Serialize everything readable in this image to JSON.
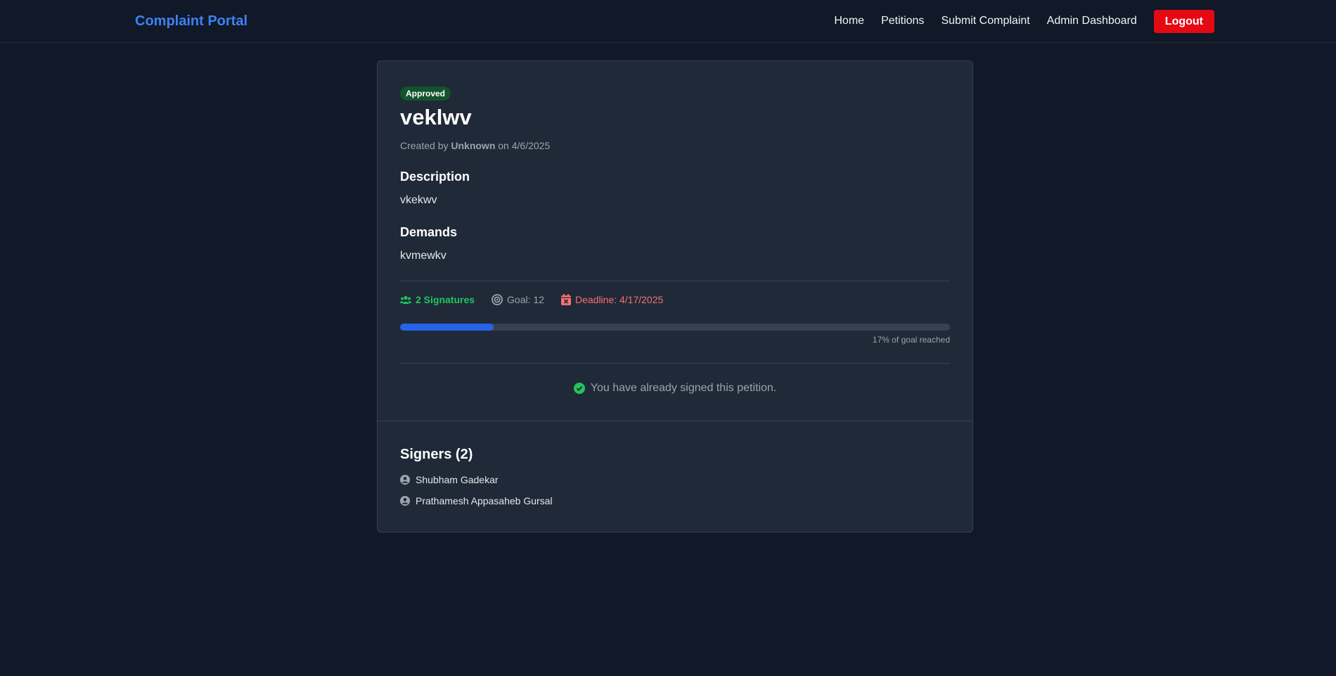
{
  "nav": {
    "brand": "Complaint Portal",
    "links": [
      "Home",
      "Petitions",
      "Submit Complaint",
      "Admin Dashboard"
    ],
    "logout": "Logout"
  },
  "petition": {
    "status": "Approved",
    "title": "veklwv",
    "created_prefix": "Created by",
    "author": "Unknown",
    "created_suffix": "on 4/6/2025",
    "description_heading": "Description",
    "description": "vkekwv",
    "demands_heading": "Demands",
    "demands": "kvmewkv",
    "signatures": "2 Signatures",
    "goal": "Goal: 12",
    "deadline": "Deadline: 4/17/2025",
    "progress_fraction": 0.17,
    "progress_caption": "17% of goal reached",
    "signed_message": "You have already signed this petition."
  },
  "signers": {
    "heading": "Signers (2)",
    "list": [
      "Shubham Gadekar",
      "Prathamesh Appasaheb Gursal"
    ]
  },
  "colors": {
    "background": "#111827",
    "card": "#1f2937",
    "brand": "#3b82f6",
    "logout": "#e50914",
    "signatures": "#22c55e",
    "deadline": "#f87171",
    "progress": "#2563eb"
  },
  "icons": [
    "users-icon",
    "target-icon",
    "calendar-x-icon",
    "check-circle-icon",
    "user-circle-icon"
  ]
}
